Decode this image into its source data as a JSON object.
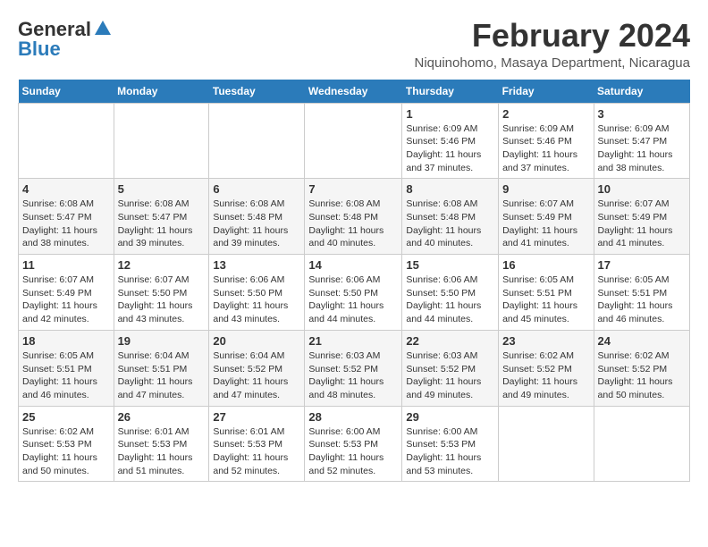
{
  "logo": {
    "general": "General",
    "blue": "Blue"
  },
  "title": "February 2024",
  "subtitle": "Niquinohomo, Masaya Department, Nicaragua",
  "days_of_week": [
    "Sunday",
    "Monday",
    "Tuesday",
    "Wednesday",
    "Thursday",
    "Friday",
    "Saturday"
  ],
  "weeks": [
    [
      {
        "day": "",
        "info": ""
      },
      {
        "day": "",
        "info": ""
      },
      {
        "day": "",
        "info": ""
      },
      {
        "day": "",
        "info": ""
      },
      {
        "day": "1",
        "info": "Sunrise: 6:09 AM\nSunset: 5:46 PM\nDaylight: 11 hours and 37 minutes."
      },
      {
        "day": "2",
        "info": "Sunrise: 6:09 AM\nSunset: 5:46 PM\nDaylight: 11 hours and 37 minutes."
      },
      {
        "day": "3",
        "info": "Sunrise: 6:09 AM\nSunset: 5:47 PM\nDaylight: 11 hours and 38 minutes."
      }
    ],
    [
      {
        "day": "4",
        "info": "Sunrise: 6:08 AM\nSunset: 5:47 PM\nDaylight: 11 hours and 38 minutes."
      },
      {
        "day": "5",
        "info": "Sunrise: 6:08 AM\nSunset: 5:47 PM\nDaylight: 11 hours and 39 minutes."
      },
      {
        "day": "6",
        "info": "Sunrise: 6:08 AM\nSunset: 5:48 PM\nDaylight: 11 hours and 39 minutes."
      },
      {
        "day": "7",
        "info": "Sunrise: 6:08 AM\nSunset: 5:48 PM\nDaylight: 11 hours and 40 minutes."
      },
      {
        "day": "8",
        "info": "Sunrise: 6:08 AM\nSunset: 5:48 PM\nDaylight: 11 hours and 40 minutes."
      },
      {
        "day": "9",
        "info": "Sunrise: 6:07 AM\nSunset: 5:49 PM\nDaylight: 11 hours and 41 minutes."
      },
      {
        "day": "10",
        "info": "Sunrise: 6:07 AM\nSunset: 5:49 PM\nDaylight: 11 hours and 41 minutes."
      }
    ],
    [
      {
        "day": "11",
        "info": "Sunrise: 6:07 AM\nSunset: 5:49 PM\nDaylight: 11 hours and 42 minutes."
      },
      {
        "day": "12",
        "info": "Sunrise: 6:07 AM\nSunset: 5:50 PM\nDaylight: 11 hours and 43 minutes."
      },
      {
        "day": "13",
        "info": "Sunrise: 6:06 AM\nSunset: 5:50 PM\nDaylight: 11 hours and 43 minutes."
      },
      {
        "day": "14",
        "info": "Sunrise: 6:06 AM\nSunset: 5:50 PM\nDaylight: 11 hours and 44 minutes."
      },
      {
        "day": "15",
        "info": "Sunrise: 6:06 AM\nSunset: 5:50 PM\nDaylight: 11 hours and 44 minutes."
      },
      {
        "day": "16",
        "info": "Sunrise: 6:05 AM\nSunset: 5:51 PM\nDaylight: 11 hours and 45 minutes."
      },
      {
        "day": "17",
        "info": "Sunrise: 6:05 AM\nSunset: 5:51 PM\nDaylight: 11 hours and 46 minutes."
      }
    ],
    [
      {
        "day": "18",
        "info": "Sunrise: 6:05 AM\nSunset: 5:51 PM\nDaylight: 11 hours and 46 minutes."
      },
      {
        "day": "19",
        "info": "Sunrise: 6:04 AM\nSunset: 5:51 PM\nDaylight: 11 hours and 47 minutes."
      },
      {
        "day": "20",
        "info": "Sunrise: 6:04 AM\nSunset: 5:52 PM\nDaylight: 11 hours and 47 minutes."
      },
      {
        "day": "21",
        "info": "Sunrise: 6:03 AM\nSunset: 5:52 PM\nDaylight: 11 hours and 48 minutes."
      },
      {
        "day": "22",
        "info": "Sunrise: 6:03 AM\nSunset: 5:52 PM\nDaylight: 11 hours and 49 minutes."
      },
      {
        "day": "23",
        "info": "Sunrise: 6:02 AM\nSunset: 5:52 PM\nDaylight: 11 hours and 49 minutes."
      },
      {
        "day": "24",
        "info": "Sunrise: 6:02 AM\nSunset: 5:52 PM\nDaylight: 11 hours and 50 minutes."
      }
    ],
    [
      {
        "day": "25",
        "info": "Sunrise: 6:02 AM\nSunset: 5:53 PM\nDaylight: 11 hours and 50 minutes."
      },
      {
        "day": "26",
        "info": "Sunrise: 6:01 AM\nSunset: 5:53 PM\nDaylight: 11 hours and 51 minutes."
      },
      {
        "day": "27",
        "info": "Sunrise: 6:01 AM\nSunset: 5:53 PM\nDaylight: 11 hours and 52 minutes."
      },
      {
        "day": "28",
        "info": "Sunrise: 6:00 AM\nSunset: 5:53 PM\nDaylight: 11 hours and 52 minutes."
      },
      {
        "day": "29",
        "info": "Sunrise: 6:00 AM\nSunset: 5:53 PM\nDaylight: 11 hours and 53 minutes."
      },
      {
        "day": "",
        "info": ""
      },
      {
        "day": "",
        "info": ""
      }
    ]
  ]
}
